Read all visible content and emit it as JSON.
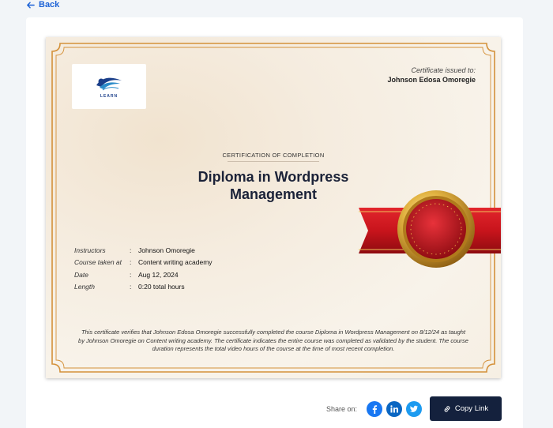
{
  "nav": {
    "back_label": "Back"
  },
  "certificate": {
    "logo_text": "LEARN",
    "issued_to_label": "Certificate issued to:",
    "recipient_name": "Johnson Edosa Omoregie",
    "kicker": "CERTIFICATION OF COMPLETION",
    "title_line1": "Diploma in Wordpress",
    "title_line2": "Management",
    "details": [
      {
        "label": "Instructors",
        "value": "Johnson Omoregie"
      },
      {
        "label": "Course taken at",
        "value": "Content writing academy"
      },
      {
        "label": "Date",
        "value": "Aug 12, 2024"
      },
      {
        "label": "Length",
        "value": "0:20 total hours"
      }
    ],
    "detail_separator": ":",
    "verification_text": "This certificate verifies that Johnson Edosa Omoregie successfully completed the course Diploma in Wordpress Management on 8/12/24 as taught by Johnson Omoregie on Content writing academy. The certificate indicates the entire course was completed as validated by the student. The course duration represents the total video hours of the course at the time of most recent completion."
  },
  "share": {
    "label": "Share on:",
    "networks": [
      {
        "name": "facebook",
        "icon": "facebook-icon",
        "color": "#1877f2"
      },
      {
        "name": "linkedin",
        "icon": "linkedin-icon",
        "color": "#0a66c2"
      },
      {
        "name": "twitter",
        "icon": "twitter-icon",
        "color": "#1d9bf0"
      }
    ],
    "copy_label": "Copy Link"
  },
  "colors": {
    "accent": "#1e63d6",
    "button_dark": "#14213d",
    "frame_gold": "#d4913a",
    "ribbon_red": "#c8141c"
  }
}
